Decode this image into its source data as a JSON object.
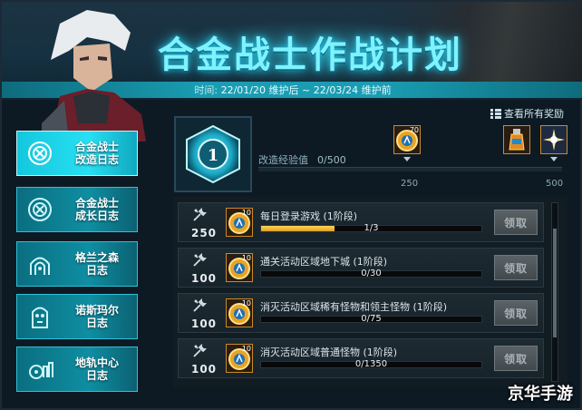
{
  "header": {
    "title": "合金战士作战计划",
    "time_prefix": "时间:",
    "time_range": "22/01/20 维护后 ~ 22/03/24 维护前"
  },
  "sidebar": {
    "items": [
      {
        "line1": "合金战士",
        "line2": "改造日志",
        "active": true,
        "icon": "x-circle-icon"
      },
      {
        "line1": "合金战士",
        "line2": "成长日志",
        "active": false,
        "icon": "x-circle-icon"
      },
      {
        "line1": "格兰之森",
        "line2": "日志",
        "active": false,
        "icon": "forest-arch-icon"
      },
      {
        "line1": "诺斯玛尔",
        "line2": "日志",
        "active": false,
        "icon": "tombstone-icon"
      },
      {
        "line1": "地轨中心",
        "line2": "日志",
        "active": false,
        "icon": "gear-city-icon"
      }
    ]
  },
  "level": {
    "value": "1"
  },
  "rewards_link": "查看所有奖励",
  "exp": {
    "label": "改造经验值",
    "value": "0/500",
    "progress": 0
  },
  "ticks": [
    "250",
    "500"
  ],
  "milestone_rewards": [
    {
      "qty": "70",
      "icon": "medal-icon"
    },
    {
      "qty": "",
      "icon": "bottle-icon"
    },
    {
      "qty": "",
      "icon": "sparkle-icon"
    }
  ],
  "tasks": [
    {
      "points": "250",
      "medal_qty": "10",
      "name": "每日登录游戏 (1阶段)",
      "progress_text": "1/3",
      "progress": 0.333,
      "button": "领取"
    },
    {
      "points": "100",
      "medal_qty": "10",
      "name": "通关活动区域地下城 (1阶段)",
      "progress_text": "0/30",
      "progress": 0,
      "button": "领取"
    },
    {
      "points": "100",
      "medal_qty": "10",
      "name": "消灭活动区域稀有怪物和领主怪物 (1阶段)",
      "progress_text": "0/75",
      "progress": 0,
      "button": "领取"
    },
    {
      "points": "100",
      "medal_qty": "10",
      "name": "消灭活动区域普通怪物 (1阶段)",
      "progress_text": "0/1350",
      "progress": 0,
      "button": "领取"
    }
  ],
  "watermark": "京华手游",
  "colors": {
    "accent": "#28dff2",
    "title": "#7ff2ff",
    "progress_fill": "#e0a020"
  }
}
